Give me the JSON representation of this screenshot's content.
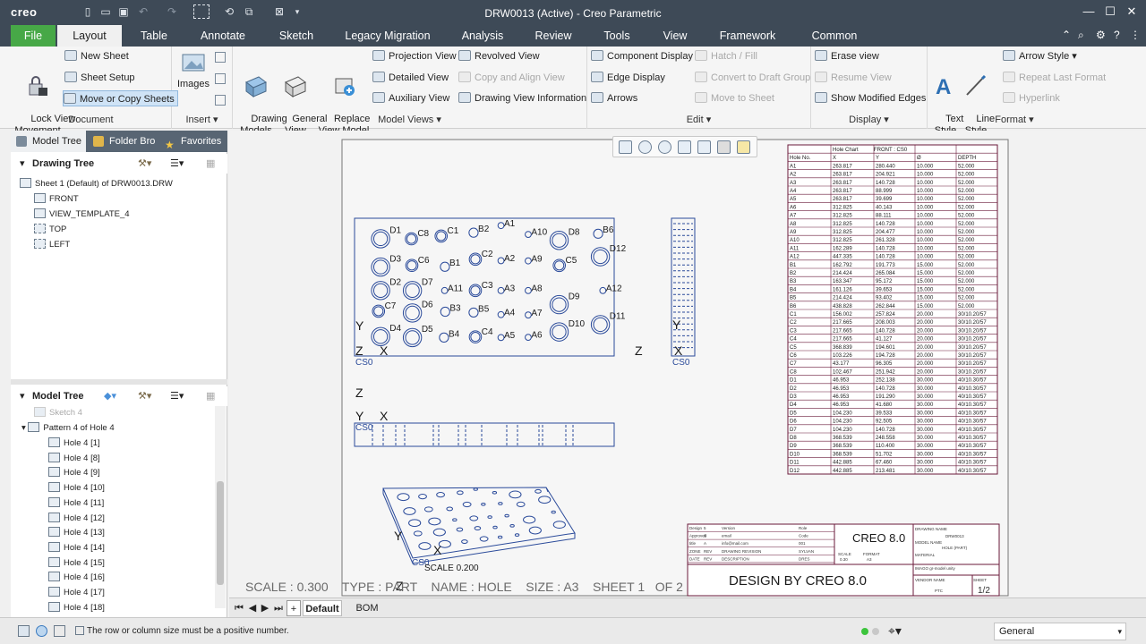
{
  "app": {
    "logo": "creo",
    "title": "DRW0013 (Active) - Creo Parametric"
  },
  "tabs": [
    "File",
    "Layout",
    "Table",
    "Annotate",
    "Sketch",
    "Legacy Migration",
    "Analysis",
    "Review",
    "Tools",
    "View",
    "Framework",
    "Common"
  ],
  "ribbon": {
    "document": {
      "label": "Document",
      "lock": "Lock View\nMovement",
      "new_sheet": "New Sheet",
      "sheet_setup": "Sheet Setup",
      "move_copy": "Move or Copy Sheets"
    },
    "insert": {
      "label": "Insert",
      "images": "Images"
    },
    "model_views": {
      "label": "Model Views",
      "drawing_models": "Drawing\nModels",
      "general_view": "General\nView",
      "replace_view": "Replace\nView Model",
      "projection": "Projection View",
      "detailed": "Detailed View",
      "auxiliary": "Auxiliary View",
      "revolved": "Revolved View",
      "copy_align": "Copy and Align View",
      "drawing_info": "Drawing View Information"
    },
    "edit": {
      "label": "Edit",
      "component_display": "Component Display",
      "edge_display": "Edge Display",
      "arrows": "Arrows",
      "hatch": "Hatch / Fill",
      "convert": "Convert to Draft Group",
      "move_sheet": "Move to Sheet"
    },
    "display": {
      "label": "Display",
      "erase": "Erase view",
      "resume": "Resume View",
      "show_modified": "Show Modified Edges"
    },
    "format": {
      "label": "Format",
      "text_style": "Text\nStyle",
      "line_style": "Line\nStyle",
      "arrow_style": "Arrow Style",
      "repeat": "Repeat Last Format",
      "hyperlink": "Hyperlink"
    }
  },
  "left": {
    "tabs": [
      "Model Tree",
      "Folder Bro",
      "Favorites"
    ],
    "drawing_tree": {
      "title": "Drawing Tree",
      "items": [
        "Sheet 1 (Default) of DRW0013.DRW",
        "FRONT",
        "VIEW_TEMPLATE_4",
        "TOP",
        "LEFT"
      ]
    },
    "model_tree": {
      "title": "Model Tree",
      "items": [
        "Sketch 4",
        "Pattern 4 of Hole 4",
        "Hole 4 [1]",
        "Hole 4 [8]",
        "Hole 4 [9]",
        "Hole 4 [10]",
        "Hole 4 [11]",
        "Hole 4 [12]",
        "Hole 4 [13]",
        "Hole 4 [14]",
        "Hole 4 [15]",
        "Hole 4 [16]",
        "Hole 4 [17]",
        "Hole 4 [18]"
      ]
    }
  },
  "drawing": {
    "sheet_info": "SCALE : 0.300    TYPE : PART    NAME : HOLE    SIZE : A3    SHEET 1   OF 2",
    "scale_label": "SCALE 0.200",
    "cs_label": "CS0",
    "axis": {
      "x": "X",
      "y": "Y",
      "z": "Z"
    },
    "front_labels": [
      "D1",
      "C8",
      "C1",
      "B2",
      "A1",
      "A10",
      "D8",
      "B6",
      "D12",
      "D3",
      "C6",
      "B1",
      "C2",
      "A2",
      "A9",
      "C5",
      "D2",
      "D7",
      "A11",
      "C3",
      "A3",
      "A8",
      "D9",
      "A12",
      "C7",
      "D6",
      "B3",
      "B5",
      "A4",
      "A7",
      "D10",
      "D11",
      "D4",
      "D5",
      "B4",
      "C4",
      "A5",
      "A6"
    ],
    "title_block": {
      "creo": "CREO 8.0",
      "design_by": "DESIGN BY CREO 8.0",
      "sheet": "1/2",
      "drawing_name": "DRAWING NAME",
      "drw": "DRW0013",
      "model_name": "MODEL NAME",
      "part": "HOLE (PART)",
      "material": "MATERIAL",
      "imago": "IMAGO gr-model unity",
      "vendor": "VENDOR NAME",
      "sheet_label": "SHEET",
      "ptc": "PTC",
      "rows": [
        [
          "Design",
          "5",
          "Version",
          "Role"
        ],
        [
          "Approved",
          "6",
          "email",
          "Code"
        ],
        [
          "title",
          "A",
          "info@mail.com",
          "001"
        ],
        [
          "ZONE",
          "REV",
          "DRAWING REVISION",
          "SYLVAN"
        ],
        [
          "DATE",
          "REV",
          "DESCRIPTION",
          "DRES"
        ]
      ],
      "scale": "SCALE",
      "scale_v": "0.30",
      "format": "FORMAT",
      "format_v": "A3"
    },
    "hole_chart": {
      "header": [
        "Hole Chart",
        "FRONT : CS0"
      ],
      "cols": [
        "Hole No.",
        "X",
        "Y",
        "Ø",
        "DEPTH"
      ],
      "rows": [
        [
          "A1",
          "263.817",
          "280.440",
          "10.000",
          "52.000"
        ],
        [
          "A2",
          "263.817",
          "204.921",
          "10.000",
          "52.000"
        ],
        [
          "A3",
          "263.817",
          "140.728",
          "10.000",
          "52.000"
        ],
        [
          "A4",
          "263.817",
          "88.999",
          "10.000",
          "52.000"
        ],
        [
          "A5",
          "263.817",
          "39.699",
          "10.000",
          "52.000"
        ],
        [
          "A6",
          "312.825",
          "40.143",
          "10.000",
          "52.000"
        ],
        [
          "A7",
          "312.825",
          "88.111",
          "10.000",
          "52.000"
        ],
        [
          "A8",
          "312.825",
          "140.728",
          "10.000",
          "52.000"
        ],
        [
          "A9",
          "312.825",
          "204.477",
          "10.000",
          "52.000"
        ],
        [
          "A10",
          "312.825",
          "261.328",
          "10.000",
          "52.000"
        ],
        [
          "A11",
          "162.289",
          "140.728",
          "10.000",
          "52.000"
        ],
        [
          "A12",
          "447.335",
          "140.728",
          "10.000",
          "52.000"
        ],
        [
          "B1",
          "162.792",
          "191.773",
          "15.000",
          "52.000"
        ],
        [
          "B2",
          "214.424",
          "265.084",
          "15.000",
          "52.000"
        ],
        [
          "B3",
          "163.347",
          "95.172",
          "15.000",
          "52.000"
        ],
        [
          "B4",
          "161.126",
          "39.653",
          "15.000",
          "52.000"
        ],
        [
          "B5",
          "214.424",
          "93.402",
          "15.000",
          "52.000"
        ],
        [
          "B6",
          "438.828",
          "262.844",
          "15.000",
          "52.000"
        ],
        [
          "C1",
          "156.002",
          "257.824",
          "20.000",
          "30/10.20/57"
        ],
        [
          "C2",
          "217.665",
          "208.003",
          "20.000",
          "30/10.20/57"
        ],
        [
          "C3",
          "217.665",
          "140.728",
          "20.000",
          "30/10.20/57"
        ],
        [
          "C4",
          "217.665",
          "41.127",
          "20.000",
          "30/10.20/57"
        ],
        [
          "C5",
          "368.839",
          "194.601",
          "20.000",
          "30/10.20/57"
        ],
        [
          "C6",
          "103.226",
          "194.728",
          "20.000",
          "30/10.20/57"
        ],
        [
          "C7",
          "43.177",
          "96.305",
          "20.000",
          "30/10.20/57"
        ],
        [
          "C8",
          "102.467",
          "251.942",
          "20.000",
          "30/10.20/57"
        ],
        [
          "D1",
          "46.953",
          "252.138",
          "30.000",
          "40/10.30/57"
        ],
        [
          "D2",
          "46.953",
          "140.728",
          "30.000",
          "40/10.30/57"
        ],
        [
          "D3",
          "46.953",
          "191.290",
          "30.000",
          "40/10.30/57"
        ],
        [
          "D4",
          "46.953",
          "41.680",
          "30.000",
          "40/10.30/57"
        ],
        [
          "D5",
          "104.230",
          "39.533",
          "30.000",
          "40/10.30/57"
        ],
        [
          "D6",
          "104.230",
          "92.505",
          "30.000",
          "40/10.30/57"
        ],
        [
          "D7",
          "104.230",
          "140.728",
          "30.000",
          "40/10.30/57"
        ],
        [
          "D8",
          "368.539",
          "248.558",
          "30.000",
          "40/10.30/57"
        ],
        [
          "D9",
          "368.539",
          "110.400",
          "30.000",
          "40/10.30/57"
        ],
        [
          "D10",
          "368.539",
          "51.702",
          "30.000",
          "40/10.30/57"
        ],
        [
          "D11",
          "442.885",
          "67.460",
          "30.000",
          "40/10.30/57"
        ],
        [
          "D12",
          "442.885",
          "213.481",
          "30.000",
          "40/10.30/57"
        ]
      ]
    }
  },
  "sheet_tabs": [
    "Default",
    "BOM"
  ],
  "status": {
    "message": "The row or column size must be a positive number.",
    "filter": "General"
  }
}
